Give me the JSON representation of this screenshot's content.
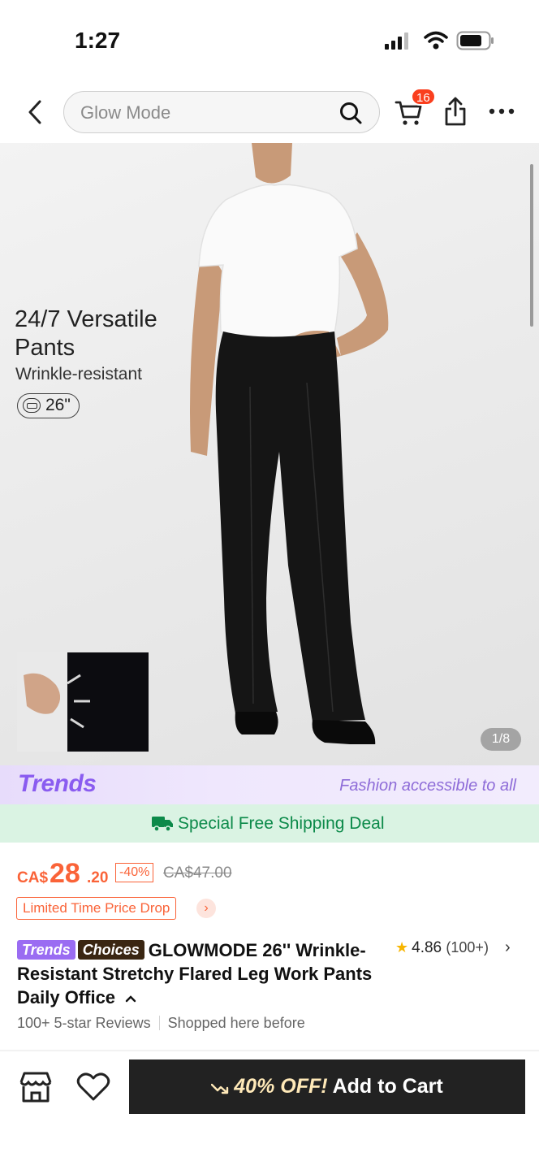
{
  "status_bar": {
    "time": "1:27"
  },
  "nav": {
    "search_placeholder": "Glow Mode",
    "cart_count": "16"
  },
  "hero": {
    "headline": "24/7 Versatile Pants",
    "subtitle": "Wrinkle-resistant",
    "length_badge": "26\"",
    "image_counter": "1/8"
  },
  "trends_banner": {
    "logo": "Trends",
    "tagline": "Fashion accessible to all"
  },
  "shipping_banner": {
    "text": "Special Free Shipping Deal"
  },
  "price": {
    "currency": "CA$",
    "integer": "28",
    "decimals": ".20",
    "discount": "-40%",
    "original": "CA$47.00",
    "promo_label": "Limited Time Price Drop"
  },
  "product": {
    "tag_trends": "Trends",
    "tag_choices": "Choices",
    "title": "GLOWMODE 26'' Wrinkle-Resistant Stretchy Flared Leg Work Pants Daily Office",
    "rating": "4.86",
    "review_count": "(100+)",
    "reviews_note": "100+ 5-star Reviews",
    "shopped_note": "Shopped here before"
  },
  "bottom_bar": {
    "cta_discount": "40% OFF!",
    "cta_label": "Add to Cart"
  },
  "colors": {
    "accent": "#fa6338",
    "trends": "#8a5cf0",
    "shipping": "#0c8a4a",
    "cta_bg": "#222222"
  }
}
